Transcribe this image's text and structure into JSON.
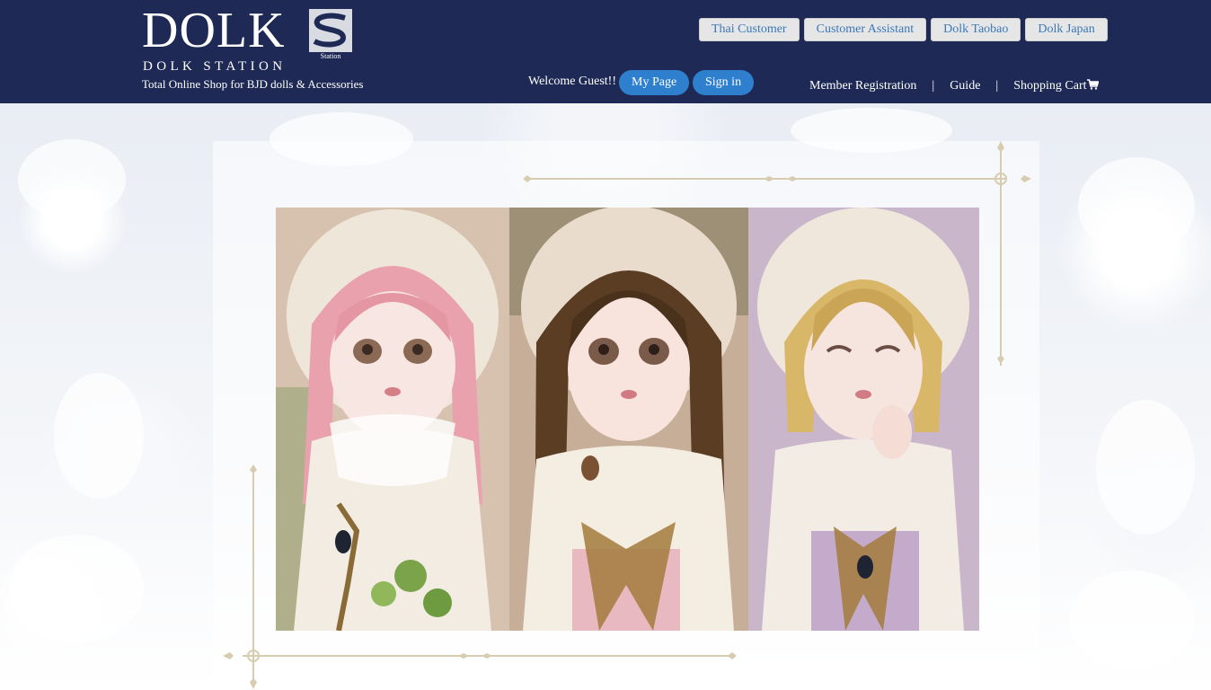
{
  "header": {
    "logo": {
      "wordmark": "DOLK",
      "mark_text": "Station",
      "subtitle": "DOLK STATION",
      "tagline": "Total Online Shop for BJD dolls & Accessories"
    },
    "top_buttons": [
      {
        "label": "Thai Customer"
      },
      {
        "label": "Customer Assistant"
      },
      {
        "label": "Dolk Taobao"
      },
      {
        "label": "Dolk Japan"
      }
    ],
    "welcome_text": "Welcome Guest!!",
    "my_page_label": "My Page",
    "sign_in_label": "Sign in",
    "nav_links": [
      {
        "label": "Member Registration"
      },
      {
        "label": "Guide"
      },
      {
        "label": "Shopping Cart"
      }
    ],
    "nav_separator": "|"
  },
  "banner": {
    "dolls": [
      {
        "hair": "pink",
        "hair_color": "#e9a2ad",
        "bg_color": "#d7c4b2"
      },
      {
        "hair": "brown",
        "hair_color": "#5b3d24",
        "bg_color": "#c9b29c"
      },
      {
        "hair": "blonde",
        "hair_color": "#d9b768",
        "bg_color": "#c7b3c9"
      }
    ]
  },
  "colors": {
    "header_bg": "#1e2a55",
    "pill_blue": "#2f7fcf",
    "top_button_text": "#3a78b8",
    "frame_gold": "#d8ccb0"
  }
}
